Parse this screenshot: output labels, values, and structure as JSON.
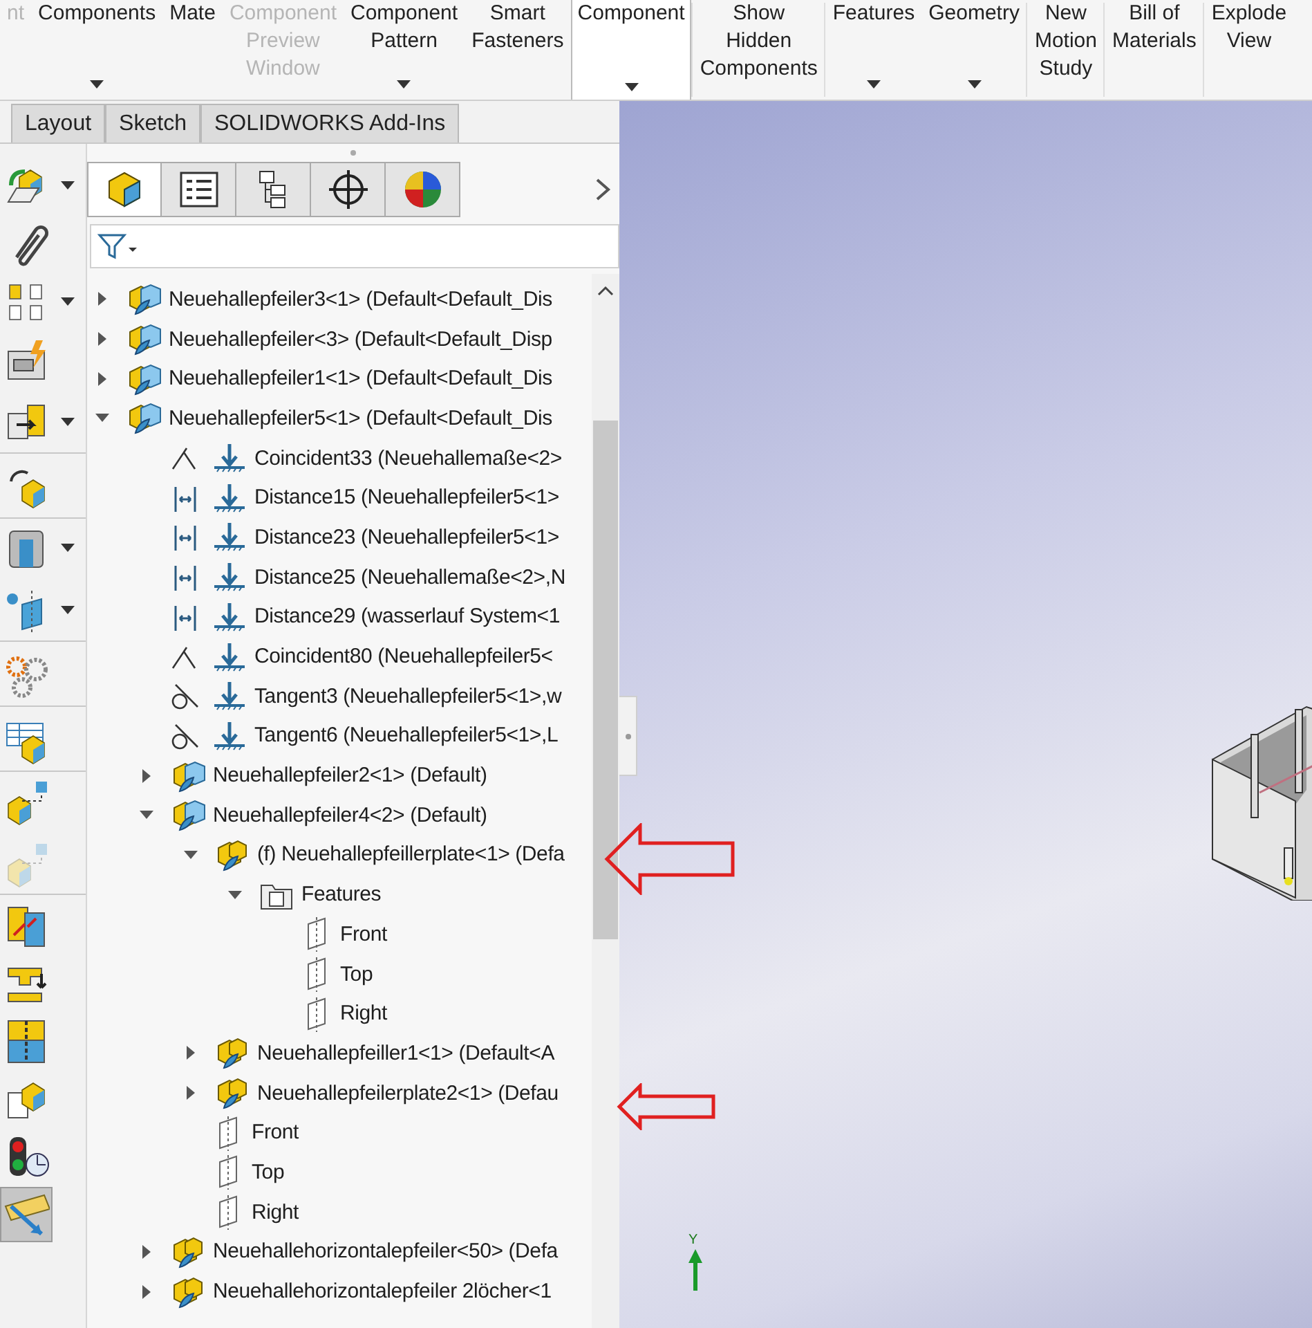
{
  "ribbon": [
    {
      "label": "nt",
      "disabled": true,
      "dropdown": false,
      "kind": "plain"
    },
    {
      "label": "Components",
      "disabled": false,
      "dropdown": true,
      "kind": "plain"
    },
    {
      "label": "Mate",
      "disabled": false,
      "dropdown": false,
      "kind": "plain"
    },
    {
      "label": "Component\nPreview\nWindow",
      "disabled": true,
      "dropdown": false,
      "kind": "plain"
    },
    {
      "label": "Component\nPattern",
      "disabled": false,
      "dropdown": true,
      "kind": "plain"
    },
    {
      "label": "Smart\nFasteners",
      "disabled": false,
      "dropdown": false,
      "kind": "plain"
    },
    {
      "label": "Component",
      "disabled": false,
      "dropdown": true,
      "kind": "split"
    },
    {
      "label": "Show\nHidden\nComponents",
      "disabled": false,
      "dropdown": false,
      "kind": "plain"
    },
    {
      "label": "Features",
      "disabled": false,
      "dropdown": true,
      "kind": "plain"
    },
    {
      "label": "Geometry",
      "disabled": false,
      "dropdown": true,
      "kind": "plain"
    },
    {
      "label": "New\nMotion\nStudy",
      "disabled": false,
      "dropdown": false,
      "kind": "plain"
    },
    {
      "label": "Bill of\nMaterials",
      "disabled": false,
      "dropdown": false,
      "kind": "plain"
    },
    {
      "label": "Explode\nView",
      "disabled": false,
      "dropdown": false,
      "kind": "plain"
    }
  ],
  "tabs": [
    {
      "label": "Layout",
      "selected": false
    },
    {
      "label": "Sketch",
      "selected": false
    },
    {
      "label": "SOLIDWORKS Add-Ins",
      "selected": false
    }
  ],
  "left_toolbar": [
    {
      "kind": "insert",
      "dropdown": true,
      "selected": false,
      "disabled": false,
      "group_end": false
    },
    {
      "kind": "paperclip",
      "dropdown": false,
      "selected": false,
      "disabled": false,
      "group_end": false
    },
    {
      "kind": "pattern",
      "dropdown": true,
      "selected": false,
      "disabled": false,
      "group_end": false
    },
    {
      "kind": "fastener",
      "dropdown": false,
      "selected": false,
      "disabled": false,
      "group_end": false
    },
    {
      "kind": "move",
      "dropdown": true,
      "selected": false,
      "disabled": false,
      "group_end": true
    },
    {
      "kind": "replace",
      "dropdown": false,
      "selected": false,
      "disabled": false,
      "group_end": true
    },
    {
      "kind": "hidden",
      "dropdown": true,
      "selected": false,
      "disabled": false,
      "group_end": false
    },
    {
      "kind": "reference",
      "dropdown": true,
      "selected": false,
      "disabled": false,
      "group_end": true
    },
    {
      "kind": "gears",
      "dropdown": false,
      "selected": false,
      "disabled": false,
      "group_end": true
    },
    {
      "kind": "table",
      "dropdown": false,
      "selected": false,
      "disabled": false,
      "group_end": true
    },
    {
      "kind": "explode",
      "dropdown": false,
      "selected": false,
      "disabled": false,
      "group_end": false
    },
    {
      "kind": "explode",
      "dropdown": false,
      "selected": false,
      "disabled": true,
      "group_end": true
    },
    {
      "kind": "interference",
      "dropdown": false,
      "selected": false,
      "disabled": false,
      "group_end": false
    },
    {
      "kind": "clearance",
      "dropdown": false,
      "selected": false,
      "disabled": false,
      "group_end": false
    },
    {
      "kind": "section",
      "dropdown": false,
      "selected": false,
      "disabled": false,
      "group_end": false
    },
    {
      "kind": "document",
      "dropdown": false,
      "selected": false,
      "disabled": false,
      "group_end": false
    },
    {
      "kind": "traffic",
      "dropdown": false,
      "selected": false,
      "disabled": false,
      "group_end": false
    },
    {
      "kind": "ruler",
      "dropdown": false,
      "selected": true,
      "disabled": false,
      "group_end": false
    }
  ],
  "panel_tabs": [
    {
      "kind": "cube",
      "selected": true
    },
    {
      "kind": "list",
      "selected": false
    },
    {
      "kind": "config",
      "selected": false
    },
    {
      "kind": "crosshair",
      "selected": false
    },
    {
      "kind": "sphere",
      "selected": false
    }
  ],
  "tree": [
    {
      "kind": "assembly",
      "label": "Neuehallepfeiler3<1> (Default<Default_Dis",
      "expanded": false
    },
    {
      "kind": "assembly",
      "label": "Neuehallepfeiler<3> (Default<Default_Disp",
      "expanded": false
    },
    {
      "kind": "assembly",
      "label": "Neuehallepfeiler1<1> (Default<Default_Dis",
      "expanded": false
    },
    {
      "kind": "assembly",
      "label": "Neuehallepfeiler5<1> (Default<Default_Dis",
      "expanded": true,
      "children": [
        {
          "kind": "coincident",
          "label": "Coincident33 (Neuehallemaße<2>"
        },
        {
          "kind": "distance",
          "label": "Distance15 (Neuehallepfeiler5<1>"
        },
        {
          "kind": "distance",
          "label": "Distance23 (Neuehallepfeiler5<1>"
        },
        {
          "kind": "distance",
          "label": "Distance25 (Neuehallemaße<2>,N"
        },
        {
          "kind": "distance",
          "label": "Distance29 (wasserlauf System<1"
        },
        {
          "kind": "coincident",
          "label": "Coincident80 (Neuehallepfeiler5<"
        },
        {
          "kind": "tangent",
          "label": "Tangent3 (Neuehallepfeiler5<1>,w"
        },
        {
          "kind": "tangent",
          "label": "Tangent6 (Neuehallepfeiler5<1>,L"
        },
        {
          "kind": "assembly",
          "label": "Neuehallepfeiler2<1> (Default)",
          "expanded": false
        },
        {
          "kind": "assembly",
          "label": "Neuehallepfeiler4<2> (Default)",
          "expanded": true,
          "children": [
            {
              "kind": "part",
              "label": "(f) Neuehallepfeillerplate<1> (Defa",
              "expanded": true,
              "children": [
                {
                  "kind": "folder",
                  "label": "Features",
                  "expanded": true,
                  "children": [
                    {
                      "kind": "plane",
                      "label": "Front"
                    },
                    {
                      "kind": "plane",
                      "label": "Top"
                    },
                    {
                      "kind": "plane",
                      "label": "Right"
                    }
                  ]
                }
              ]
            },
            {
              "kind": "part",
              "label": "Neuehallepfeiller1<1> (Default<A",
              "expanded": false
            },
            {
              "kind": "part",
              "label": "Neuehallepfeilerplate2<1> (Defau",
              "expanded": false
            },
            {
              "kind": "plane",
              "label": "Front"
            },
            {
              "kind": "plane",
              "label": "Top"
            },
            {
              "kind": "plane",
              "label": "Right"
            }
          ]
        },
        {
          "kind": "part",
          "label": "Neuehallehorizontalepfeiler<50> (Defa",
          "expanded": false
        },
        {
          "kind": "part",
          "label": "Neuehallehorizontalepfeiler 2löcher<1",
          "expanded": false
        }
      ]
    }
  ],
  "triad": {
    "label": "Y"
  }
}
